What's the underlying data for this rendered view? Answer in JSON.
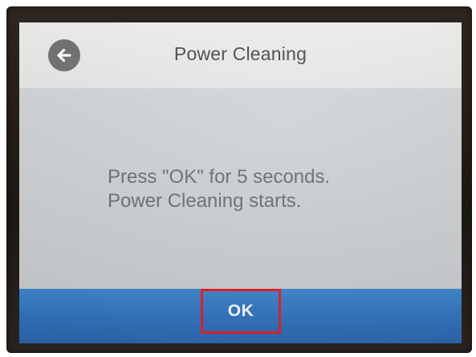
{
  "screen": {
    "title": "Power Cleaning",
    "back_icon": "arrow-left-icon",
    "message_lines": [
      "Press \"OK\" for 5 seconds.",
      "Power Cleaning starts."
    ],
    "ok_label": "OK"
  },
  "colors": {
    "title_bar": "#e9e9e7",
    "content_bg": "#cbcdd0",
    "bottom_bar": "#2f6fb8",
    "highlight_border": "#e01b24",
    "back_button": "#6f7173"
  }
}
